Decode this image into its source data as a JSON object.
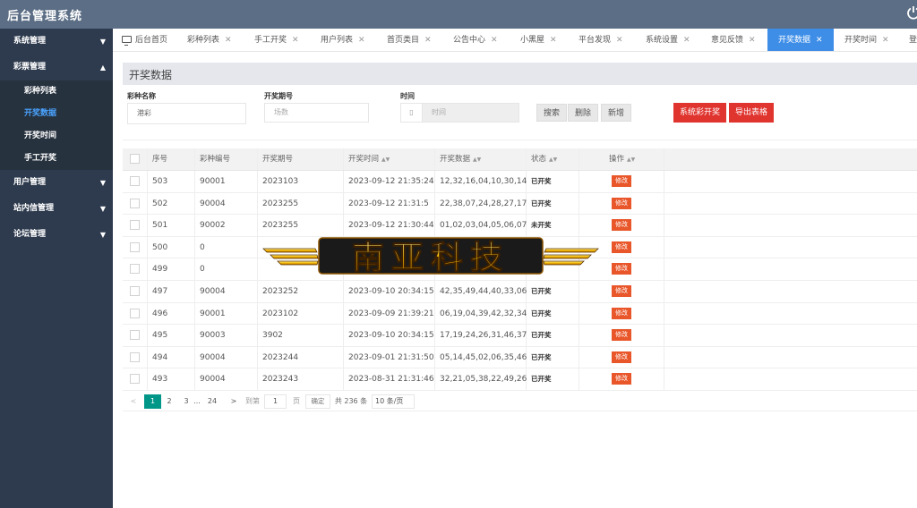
{
  "app": {
    "title": "后台管理系统",
    "power_icon": "power-icon"
  },
  "sidebar": {
    "groups": [
      {
        "label": "系统管理",
        "arrow": "▼"
      },
      {
        "label": "彩票管理",
        "arrow": "▲",
        "items": [
          {
            "label": "彩种列表",
            "active": false
          },
          {
            "label": "开奖数据",
            "active": true
          },
          {
            "label": "开奖时间",
            "active": false
          },
          {
            "label": "手工开奖",
            "active": false
          }
        ]
      },
      {
        "label": "用户管理",
        "arrow": "▼"
      },
      {
        "label": "站内信管理",
        "arrow": "▼"
      },
      {
        "label": "论坛管理",
        "arrow": "▼"
      }
    ]
  },
  "tabs": [
    {
      "label": "后台首页"
    },
    {
      "label": "彩种列表"
    },
    {
      "label": "手工开奖"
    },
    {
      "label": "用户列表"
    },
    {
      "label": "首页类目"
    },
    {
      "label": "公告中心"
    },
    {
      "label": "小黑屋"
    },
    {
      "label": "平台发现"
    },
    {
      "label": "系统设置"
    },
    {
      "label": "意见反馈"
    },
    {
      "label": "开奖数据"
    },
    {
      "label": "开奖时间"
    },
    {
      "label": "登"
    }
  ],
  "tab_close": "✕",
  "page": {
    "title": "开奖数据"
  },
  "filter": {
    "name_label": "彩种名称",
    "name_value": "港彩",
    "issue_label": "开奖期号",
    "issue_placeholder": "场数",
    "time_label": "时间",
    "time_placeholder": "时间",
    "calendar_icon": "▯",
    "search": "搜索",
    "delete": "删除",
    "add": "新增",
    "system_draw": "系统彩开奖",
    "export": "导出表格"
  },
  "table": {
    "headers": [
      "序号",
      "彩种编号",
      "开奖期号",
      "开奖时间",
      "开奖数据",
      "状态",
      "操作"
    ],
    "sort_glyph": "▲▼",
    "edit_label": "修改",
    "rows": [
      [
        "503",
        "90001",
        "2023103",
        "2023-09-12 21:35:24",
        "12,32,16,04,10,30,14",
        "已开奖"
      ],
      [
        "502",
        "90004",
        "2023255",
        "2023-09-12 21:31:5",
        "22,38,07,24,28,27,17",
        "已开奖"
      ],
      [
        "501",
        "90002",
        "2023255",
        "2023-09-12 21:30:44",
        "01,02,03,04,05,06,07",
        "未开奖"
      ],
      [
        "500",
        "0",
        "",
        "",
        "",
        ""
      ],
      [
        "499",
        "0",
        "",
        "",
        "",
        ""
      ],
      [
        "497",
        "90004",
        "2023252",
        "2023-09-10 20:34:15",
        "42,35,49,44,40,33,06",
        "已开奖"
      ],
      [
        "496",
        "90001",
        "2023102",
        "2023-09-09 21:39:21",
        "06,19,04,39,42,32,34",
        "已开奖"
      ],
      [
        "495",
        "90003",
        "3902",
        "2023-09-10 20:34:15",
        "17,19,24,26,31,46,37",
        "已开奖"
      ],
      [
        "494",
        "90004",
        "2023244",
        "2023-09-01 21:31:50",
        "05,14,45,02,06,35,46",
        "已开奖"
      ],
      [
        "493",
        "90004",
        "2023243",
        "2023-08-31 21:31:46",
        "32,21,05,38,22,49,26",
        "已开奖"
      ]
    ]
  },
  "pager": {
    "prev": "<",
    "next": ">",
    "pages": [
      "1",
      "2",
      "3",
      "...",
      "24"
    ],
    "goto_label": "到第",
    "goto_value": "1",
    "page_unit": "页",
    "confirm": "确定",
    "total": "共 236 条",
    "page_size": "10 条/页"
  },
  "watermark": {
    "text": "南亚科技"
  }
}
